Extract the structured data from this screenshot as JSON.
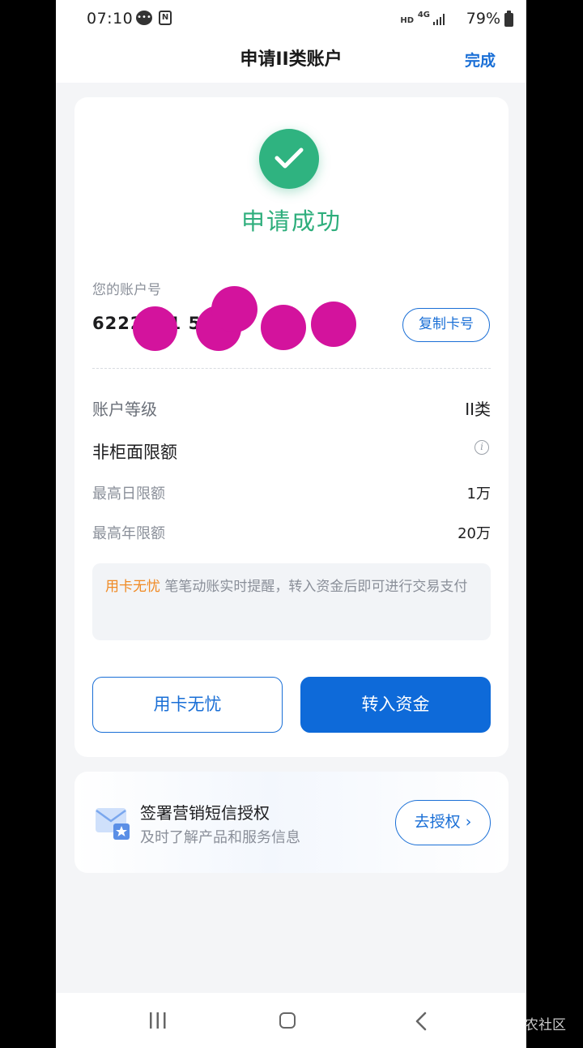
{
  "status_bar": {
    "time": "07:10",
    "hd": "HD",
    "network": "4G",
    "battery": "79%"
  },
  "header": {
    "title": "申请II类账户",
    "done_label": "完成"
  },
  "result": {
    "title": "申请成功"
  },
  "account": {
    "label": "您的账户号",
    "number_visible": "6222      3 1        5          3",
    "copy_label": "复制卡号"
  },
  "details": {
    "level_label": "账户等级",
    "level_value": "II类",
    "limit_section_label": "非柜面限额",
    "daily_label": "最高日限额",
    "daily_value": "1万",
    "yearly_label": "最高年限额",
    "yearly_value": "20万"
  },
  "notice": {
    "highlight": "用卡无忧",
    "text": " 笔笔动账实时提醒，转入资金后即可进行交易支付"
  },
  "actions": {
    "secondary_label": "用卡无忧",
    "primary_label": "转入资金"
  },
  "promo": {
    "title": "签署营销短信授权",
    "subtitle": "及时了解产品和服务信息",
    "button_label": "去授权"
  },
  "watermark": "农社区",
  "colors": {
    "accent_blue": "#1a6fd6",
    "success_green": "#2fb380",
    "highlight_orange": "#f08a24"
  }
}
